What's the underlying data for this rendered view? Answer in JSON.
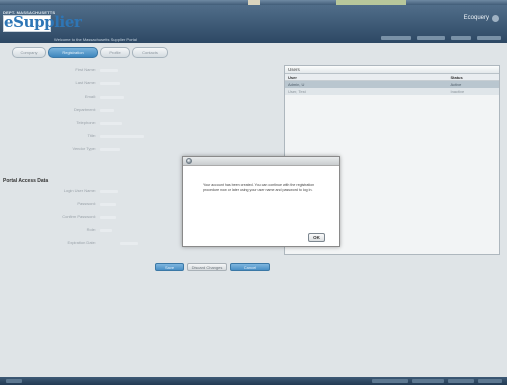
{
  "header": {
    "company": "DEPT. MASSACHUSETTS",
    "logo_text": "eSupplier",
    "welcome": "Welcome to the Massachusetts Supplier Portal",
    "user_name": "Ecoquery"
  },
  "tabs": [
    {
      "label": "Company"
    },
    {
      "label": "Registration"
    },
    {
      "label": "Profile"
    },
    {
      "label": "Contacts"
    }
  ],
  "form": {
    "fields": [
      {
        "label": "First Name:"
      },
      {
        "label": "Last Name:"
      },
      {
        "label": "Email:"
      },
      {
        "label": "Department:"
      },
      {
        "label": "Telephone:"
      },
      {
        "label": "Title:"
      },
      {
        "label": "Vendor Type:"
      }
    ],
    "portal_section_title": "Portal Access Data",
    "portal_fields": [
      {
        "label": "Login User Name:"
      },
      {
        "label": "Password:"
      },
      {
        "label": "Confirm Password:"
      },
      {
        "label": "Role:"
      },
      {
        "label": "Expiration Date:"
      }
    ]
  },
  "users_panel": {
    "title": "Users",
    "col_user": "User",
    "col_status": "Status",
    "rows": [
      {
        "user": "Admin, U",
        "status": "Active"
      },
      {
        "user": "User, Test",
        "status": "Inactive"
      }
    ]
  },
  "buttons": {
    "save": "Save",
    "discard": "Discard Changes",
    "cancel": "Cancel"
  },
  "modal": {
    "message": "Your account has been created. You can continue with the registration procedure now or later using your user name and password to log in.",
    "ok": "OK"
  },
  "colors": {
    "header": "#3b5775",
    "accent": "#4a8fc5",
    "background": "#dfe4e7"
  }
}
